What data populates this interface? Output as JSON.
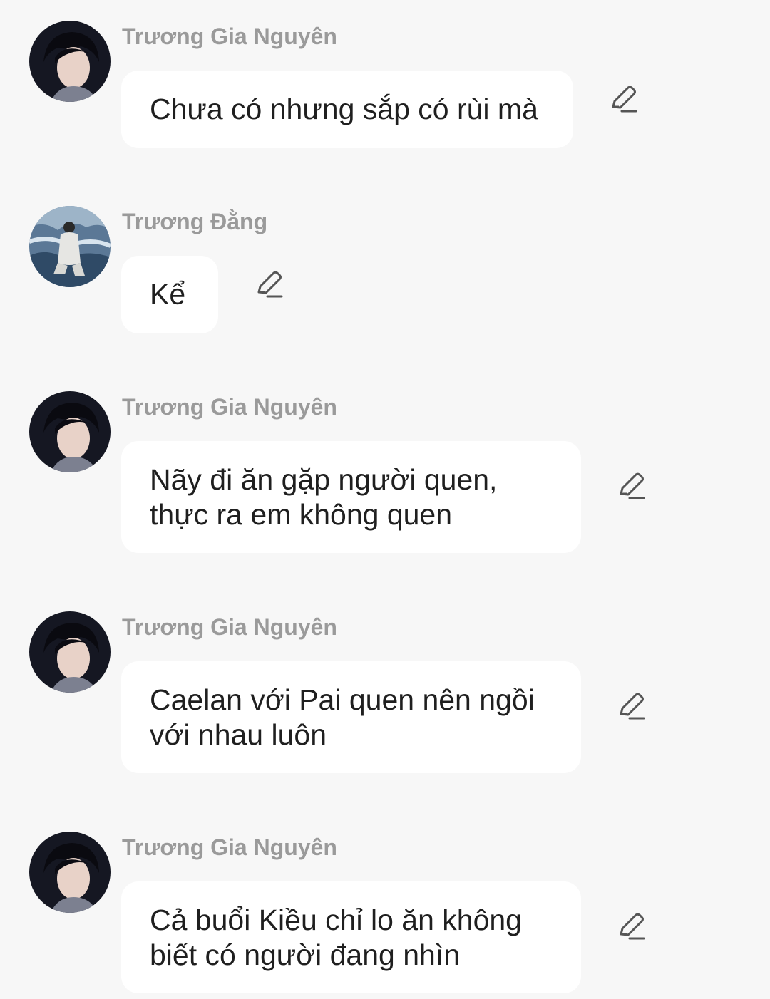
{
  "messages": [
    {
      "sender": "Trương Gia Nguyên",
      "text": "Chưa có nhưng sắp có rùi mà",
      "avatar": "portrait-dark-avatar",
      "action_icon": "edit-pencil-icon"
    },
    {
      "sender": "Trương Đằng",
      "text": "Kể",
      "avatar": "portrait-sea-avatar",
      "action_icon": "edit-pencil-icon"
    },
    {
      "sender": "Trương Gia Nguyên",
      "text": "Nãy đi ăn gặp người quen,\nthực ra em không quen",
      "avatar": "portrait-dark-avatar",
      "action_icon": "edit-pencil-icon"
    },
    {
      "sender": "Trương Gia Nguyên",
      "text": "Caelan với Pai quen nên ngồi\nvới nhau luôn",
      "avatar": "portrait-dark-avatar",
      "action_icon": "edit-pencil-icon"
    },
    {
      "sender": "Trương Gia Nguyên",
      "text": "Cả buổi Kiều chỉ lo ăn không\nbiết có người đang nhìn",
      "avatar": "portrait-dark-avatar",
      "action_icon": "edit-pencil-icon"
    }
  ],
  "colors": {
    "background": "#f7f7f7",
    "bubble": "#ffffff",
    "sender_text": "#9a9a9a",
    "message_text": "#1f1f1f",
    "icon": "#555555"
  }
}
